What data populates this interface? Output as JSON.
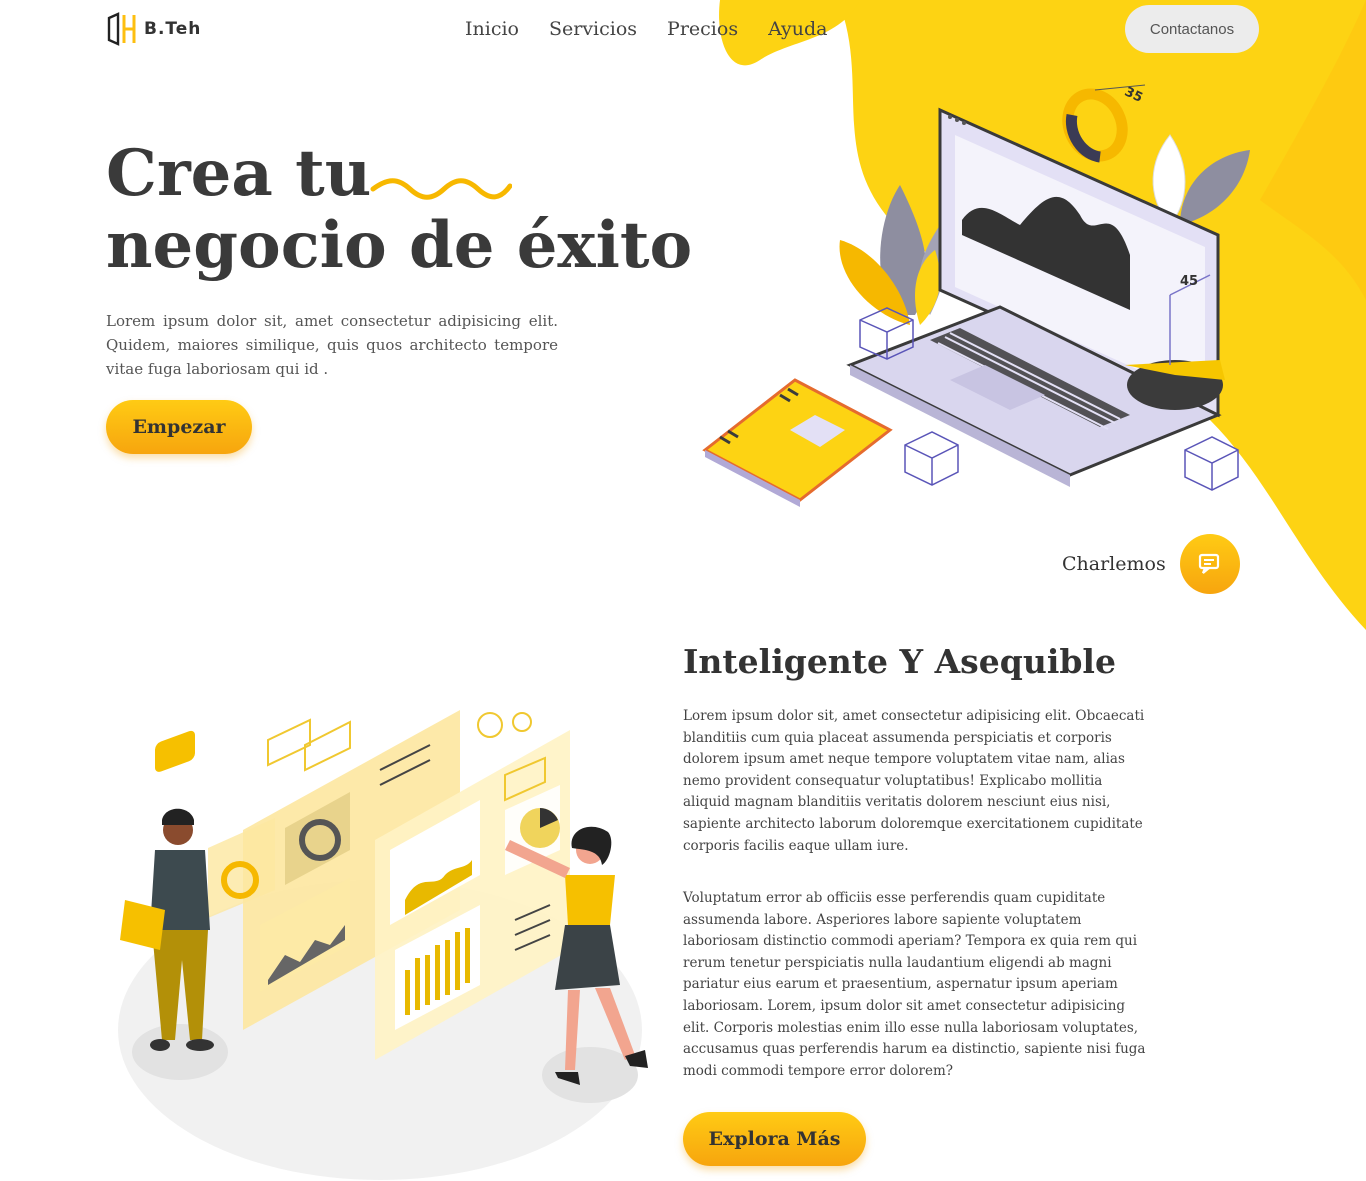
{
  "brand": {
    "name": "B.Teh"
  },
  "nav": {
    "items": [
      "Inicio",
      "Servicios",
      "Precios",
      "Ayuda"
    ],
    "contact_label": "Contactanos"
  },
  "hero": {
    "title_line1": "Crea tu",
    "title_line2": "negocio de éxito",
    "description": "Lorem ipsum dolor sit, amet consectetur adipisicing elit. Quidem, maiores similique, quis quos architecto tempore vitae fuga laboriosam qui id .",
    "cta_label": "Empezar",
    "illustration_labels": {
      "ring_value": "35",
      "pie_value": "45"
    }
  },
  "chat": {
    "label": "Charlemos",
    "icon": "chat-icon"
  },
  "feature": {
    "title": "Inteligente Y Asequible",
    "paragraph1": "Lorem ipsum dolor sit, amet consectetur adipisicing elit. Obcaecati blanditiis cum quia placeat assumenda perspiciatis et corporis dolorem ipsum amet neque tempore voluptatem vitae nam, alias nemo provident consequatur voluptatibus! Explicabo mollitia aliquid magnam blanditiis veritatis dolorem nesciunt eius nisi, sapiente architecto laborum doloremque exercitationem cupiditate corporis facilis eaque ullam iure.",
    "paragraph2": "Voluptatum error ab officiis esse perferendis quam cupiditate assumenda labore. Asperiores labore sapiente voluptatem laboriosam distinctio commodi aperiam? Tempora ex quia rem qui rerum tenetur perspiciatis nulla laudantium eligendi ab magni pariatur eius earum et praesentium, aspernatur ipsum aperiam laboriosam. Lorem, ipsum dolor sit amet consectetur adipisicing elit. Corporis molestias enim illo esse nulla laboriosam voluptates, accusamus quas perferendis harum ea distinctio, sapiente nisi fuga modi commodi tempore error dolorem?",
    "cta_label": "Explora Más"
  },
  "colors": {
    "accent": "#fdd313",
    "accent_dark": "#f7a50e",
    "text": "#333333",
    "button_grey": "#ececec"
  }
}
